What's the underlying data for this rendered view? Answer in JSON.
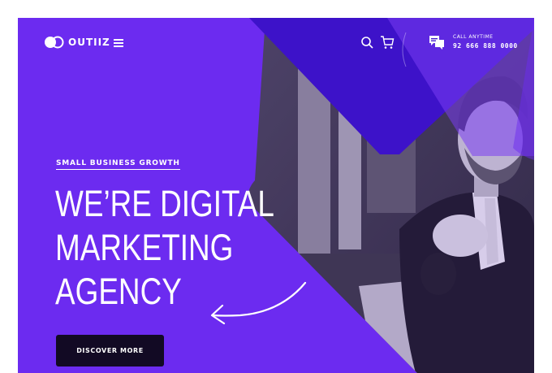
{
  "header": {
    "brand": "OUTIIZ",
    "call_label": "CALL ANYTIME",
    "call_number": "92 666 888 0000",
    "icons": {
      "logo": "logo-mark-icon",
      "menu": "hamburger-menu-icon",
      "search": "search-icon",
      "cart": "cart-icon",
      "chat": "chat-bubble-icon"
    }
  },
  "hero": {
    "tagline": "SMALL BUSINESS GROWTH",
    "headline": [
      "WE’RE DIGITAL",
      "MARKETING",
      "AGENCY"
    ],
    "cta_label": "DISCOVER MORE",
    "image": "man in suit with clasped hands in front of laptop (monochrome photo)"
  },
  "colors": {
    "primary": "#6c2bf0",
    "primary_dark": "#3d12c9",
    "button_bg": "#120a24",
    "text": "#ffffff"
  }
}
